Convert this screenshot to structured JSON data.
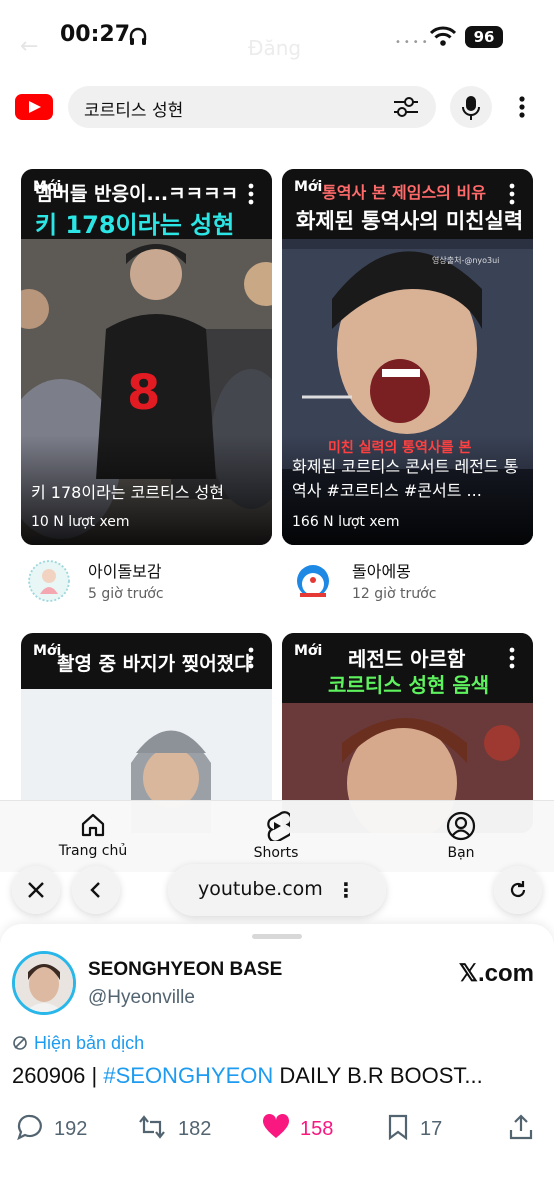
{
  "status_bar": {
    "time": "00:27",
    "battery": "96",
    "ghost_title": "Đăng"
  },
  "search": {
    "query": "코르티스 성현"
  },
  "videos": [
    {
      "badge": "Mới",
      "banner_line1": "멤버들 반응이...ㅋㅋㅋㅋ",
      "banner_line2": "키 178이라는 성현",
      "title": "키 178이라는 코르티스 성현",
      "views": "10 N lượt xem",
      "channel": "아이돌보감",
      "time": "5 giờ trước"
    },
    {
      "badge": "Mới",
      "banner_line1": "통역사 본 제임스의 비유",
      "banner_line2": "화제된 통역사의 미친실력",
      "photo_credit": "영상출처-@nyo3ui",
      "caption": "미친 실력의 통역사를 본",
      "title": "화제된 코르티스 콘서트 레전드 통역사 #코르티스 #콘서트 ...",
      "views": "166 N lượt xem",
      "channel": "돌아에몽",
      "time": "12 giờ trước"
    },
    {
      "badge": "Mới",
      "banner_line1": "촬영 중 바지가 찢어졌다",
      "banner_line2": ""
    },
    {
      "badge": "Mới",
      "banner_line1": "레전드 아르함",
      "banner_line2": "코르티스 성현 음색"
    }
  ],
  "bottom_nav": {
    "home": "Trang chủ",
    "shorts": "Shorts",
    "you": "Bạn"
  },
  "browser": {
    "url": "youtube.com"
  },
  "tweet": {
    "name": "SEONGHYEON BASE",
    "handle": "@Hyeonville",
    "source": "𝕏.com",
    "translate": "Hiện bản dịch",
    "text_prefix": "260906 | ",
    "hashtag": "#SEONGHYEON",
    "text_suffix": " DAILY B.R BOOST...",
    "replies": "192",
    "retweets": "182",
    "likes": "158",
    "bookmarks": "17"
  },
  "colors": {
    "youtube_red": "#ff0000",
    "x_blue": "#1d9bf0",
    "like_pink": "#f91880",
    "banner_cyan": "#2ce6e6",
    "banner_green": "#5ef25e"
  }
}
